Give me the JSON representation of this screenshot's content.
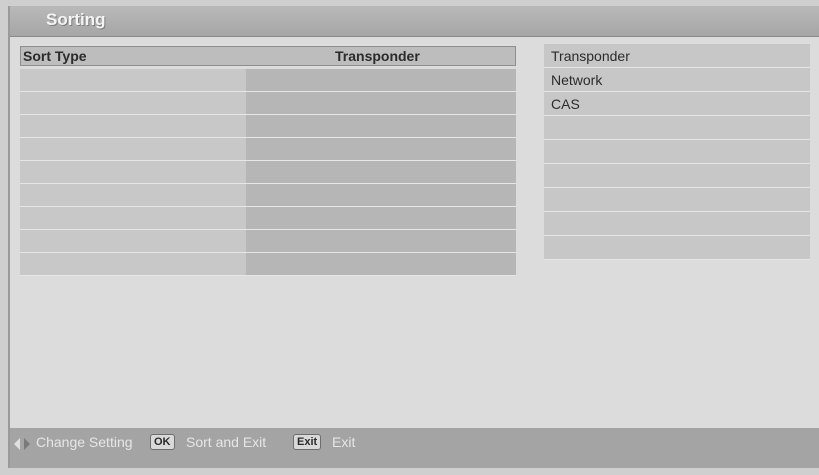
{
  "window": {
    "title": "Sorting"
  },
  "table": {
    "headers": {
      "sort_type": "Sort Type",
      "value": "Transponder"
    },
    "rows": 10
  },
  "options": [
    {
      "label": "Transponder"
    },
    {
      "label": "Network"
    },
    {
      "label": "CAS"
    },
    {
      "label": ""
    },
    {
      "label": ""
    },
    {
      "label": ""
    },
    {
      "label": ""
    },
    {
      "label": ""
    },
    {
      "label": ""
    }
  ],
  "footer": {
    "change_setting": "Change Setting",
    "ok_key": "OK",
    "sort_and_exit": "Sort and Exit",
    "exit_key": "Exit",
    "exit": "Exit"
  },
  "colors": {
    "title_bar": "#a6a6a6",
    "footer_bar": "#a4a4a4",
    "row_light": "#c8c8c8",
    "row_dark": "#b6b6b6"
  }
}
